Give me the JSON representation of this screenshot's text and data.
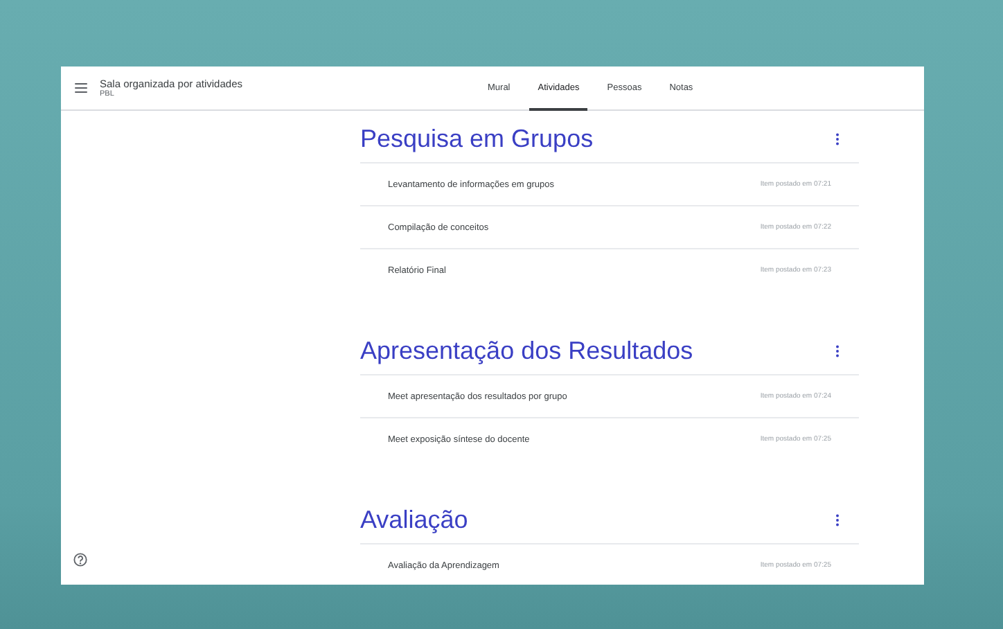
{
  "header": {
    "title": "Sala organizada por atividades",
    "subtitle": "PBL"
  },
  "tabs": [
    {
      "label": "Mural",
      "selected": false
    },
    {
      "label": "Atividades",
      "selected": true
    },
    {
      "label": "Pessoas",
      "selected": false
    },
    {
      "label": "Notas",
      "selected": false
    }
  ],
  "topics": [
    {
      "title": "Pesquisa em Grupos",
      "items": [
        {
          "title": "Levantamento de informações em grupos",
          "posted": "Item postado em 07:21"
        },
        {
          "title": "Compilação de conceitos",
          "posted": "Item postado em 07:22"
        },
        {
          "title": "Relatório Final",
          "posted": "Item postado em 07:23"
        }
      ]
    },
    {
      "title": "Apresentação dos Resultados",
      "items": [
        {
          "title": "Meet apresentação dos resultados por grupo",
          "posted": "Item postado em 07:24"
        },
        {
          "title": "Meet exposição síntese do docente",
          "posted": "Item postado em 07:25"
        }
      ]
    },
    {
      "title": "Avaliação",
      "items": [
        {
          "title": "Avaliação da Aprendizagem",
          "posted": "Item postado em 07:25"
        }
      ]
    }
  ]
}
